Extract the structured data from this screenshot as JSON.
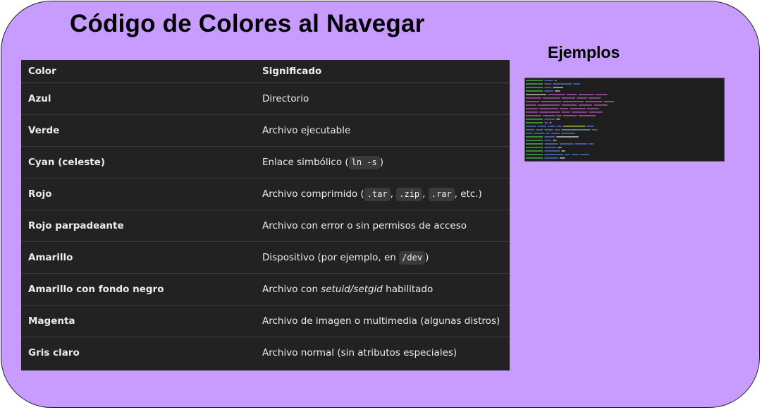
{
  "title": "Código de Colores al Navegar",
  "examples_title": "Ejemplos",
  "table": {
    "headers": [
      "Color",
      "Significado"
    ],
    "rows": [
      {
        "color": "Azul",
        "meaning": "Directorio"
      },
      {
        "color": "Verde",
        "meaning": "Archivo ejecutable"
      },
      {
        "color": "Cyan (celeste)",
        "meaning_pre": "Enlace simbólico (",
        "code": "ln -s",
        "meaning_post": ")"
      },
      {
        "color": "Rojo",
        "meaning_pre": "Archivo comprimido (",
        "codes": [
          ".tar",
          ".zip",
          ".rar"
        ],
        "meaning_post": ", etc.)"
      },
      {
        "color": "Rojo parpadeante",
        "meaning": "Archivo con error o sin permisos de acceso"
      },
      {
        "color": "Amarillo",
        "meaning_pre": "Dispositivo (por ejemplo, en ",
        "code": "/dev",
        "meaning_post": ")"
      },
      {
        "color": "Amarillo con fondo negro",
        "meaning_pre": "Archivo con ",
        "em": "setuid/setgid",
        "meaning_post": " habilitado"
      },
      {
        "color": "Magenta",
        "meaning": "Archivo de imagen o multimedia (algunas distros)"
      },
      {
        "color": "Gris claro",
        "meaning": "Archivo normal (sin atributos especiales)"
      }
    ]
  },
  "colors": {
    "card_bg": "#c89cff",
    "table_bg": "#232223",
    "table_text": "#ececec",
    "code_bg": "#3a3a3a"
  },
  "terminal_icon": "terminal-screenshot"
}
